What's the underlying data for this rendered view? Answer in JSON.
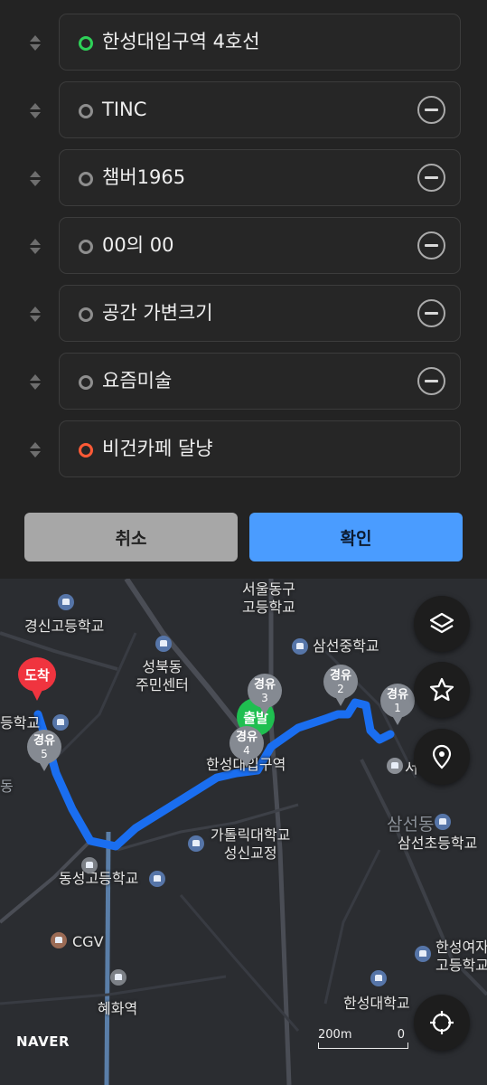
{
  "stops": [
    {
      "label": "한성대입구역 4호선",
      "type": "start",
      "removable": false
    },
    {
      "label": "TINC",
      "type": "waypoint",
      "removable": true
    },
    {
      "label": "챔버1965",
      "type": "waypoint",
      "removable": true
    },
    {
      "label": "00의 00",
      "type": "waypoint",
      "removable": true
    },
    {
      "label": "공간 가변크기",
      "type": "waypoint",
      "removable": true
    },
    {
      "label": "요즘미술",
      "type": "waypoint",
      "removable": true
    },
    {
      "label": "비건카페 달냥",
      "type": "end",
      "removable": false
    }
  ],
  "buttons": {
    "cancel": "취소",
    "confirm": "확인"
  },
  "map": {
    "labels": {
      "seoul_donggu_school": "서울동구\n고등학교",
      "gyeongsin_school": "경신고등학교",
      "samseon_middle": "삼선중학교",
      "seongbukdong_center": "성북동\n주민센터",
      "hansung_station": "한성대입구역",
      "catholic_univ": "가톨릭대학교\n성신교정",
      "samseon_elem": "삼선초등학교",
      "dongsung_school": "동성고등학교",
      "cgv": "CGV",
      "hansung_girls": "한성여자\n고등학교",
      "hyehwa_station": "혜화역",
      "hansung_univ": "한성대학교",
      "left_edge_school": "등학교",
      "left_edge_dong": "동",
      "samseon_dong": "삼선동",
      "station_seo": "서"
    },
    "start_pin": "출발",
    "end_pin": "도착",
    "waypoint_label": "경유",
    "waypoints": [
      "1",
      "2",
      "4",
      "5",
      "3"
    ],
    "brand": "NAVER",
    "scale_text": "200m",
    "scale_zero": "0"
  },
  "colors": {
    "route": "#1a6ef0",
    "start": "#2ed158",
    "end": "#ff5a36",
    "confirm": "#4a9cff"
  }
}
